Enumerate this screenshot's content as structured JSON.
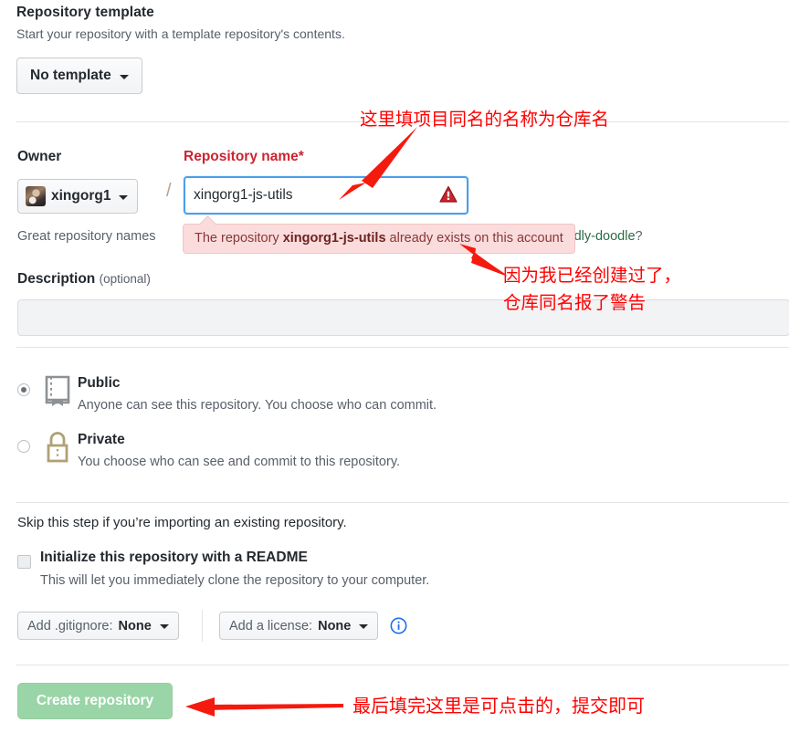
{
  "template_section": {
    "title": "Repository template",
    "subtitle": "Start your repository with a template repository's contents.",
    "button_label": "No template"
  },
  "owner_section": {
    "owner_label": "Owner",
    "owner_value": "xingorg1",
    "separator": "/",
    "repo_label": "Repository name",
    "repo_required_marker": "*",
    "repo_value": "xingorg1-js-utils",
    "warning_icon": "warning-triangle-icon"
  },
  "hint": {
    "prefix": "Great repository names",
    "suggestion": "ddly-doodle",
    "question_mark": "?"
  },
  "error_tooltip": {
    "text_before": "The repository ",
    "repo_name": "xingorg1-js-utils",
    "text_after": " already exists on this account"
  },
  "description_section": {
    "label": "Description",
    "optional": "(optional)",
    "value": "",
    "placeholder": ""
  },
  "visibility": {
    "public": {
      "title": "Public",
      "description": "Anyone can see this repository. You choose who can commit.",
      "icon": "repo-book-icon",
      "selected": true
    },
    "private": {
      "title": "Private",
      "description": "You choose who can see and commit to this repository.",
      "icon": "lock-icon",
      "selected": false
    }
  },
  "initialize_section": {
    "skip_note": "Skip this step if you’re importing an existing repository.",
    "readme_label": "Initialize this repository with a README",
    "readme_description": "This will let you immediately clone the repository to your computer.",
    "readme_checked": false,
    "gitignore_prefix": "Add .gitignore: ",
    "gitignore_value": "None",
    "license_prefix": "Add a license: ",
    "license_value": "None",
    "info_icon": "info-circle-icon"
  },
  "submit": {
    "label": "Create repository",
    "disabled": true
  },
  "annotations": [
    {
      "id": "anno-repo-name",
      "text": "这里填项目同名的名称为仓库名"
    },
    {
      "id": "anno-duplicate-warning",
      "text": "因为我已经创建过了，\n仓库同名报了警告"
    },
    {
      "id": "anno-submit",
      "text": "最后填完这里是可点击的，提交即可"
    }
  ],
  "colors": {
    "annotation_red": "#ff0000",
    "error_bg": "#fbdcdc",
    "error_text": "#86383b",
    "focus_border": "#4a9fec",
    "create_button_bg": "#94d3a2",
    "required_label": "#cb2431",
    "suggestion_green": "#2a6b45",
    "lock_icon": "#b0a175"
  }
}
